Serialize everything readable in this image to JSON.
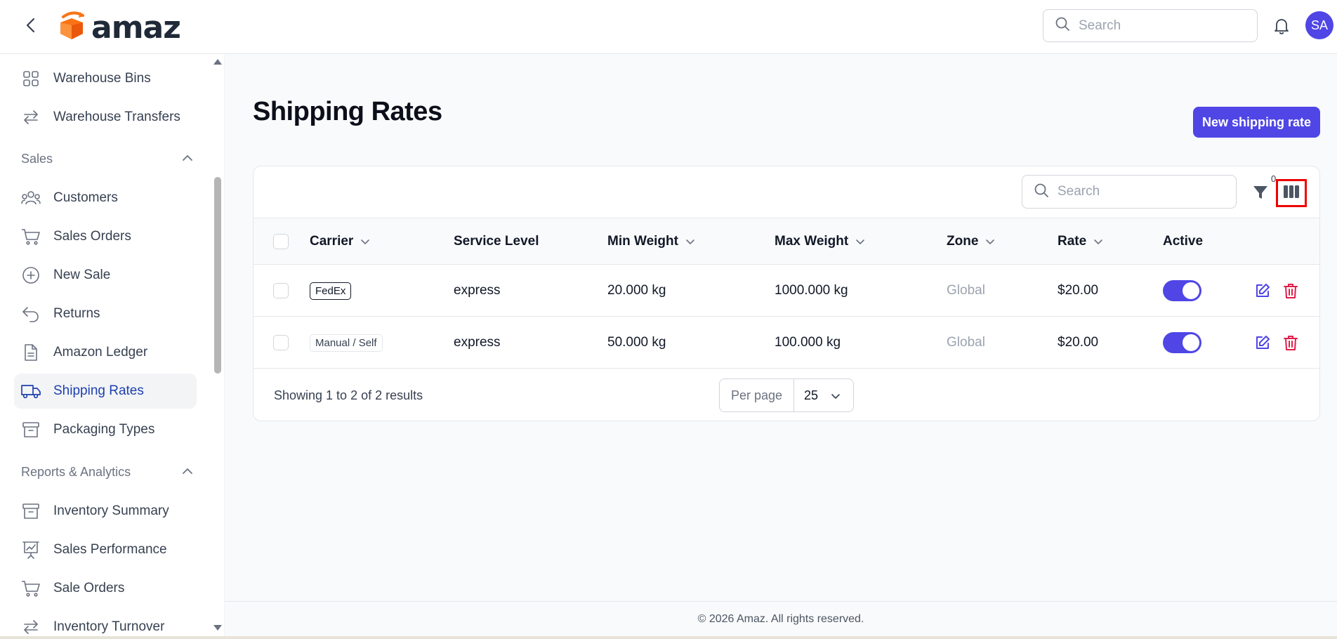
{
  "app": {
    "brand": "amaz",
    "accent": "#4f46e5"
  },
  "topbar": {
    "search_placeholder": "Search",
    "avatar_initials": "SA"
  },
  "sidebar": {
    "items_top": [
      {
        "label": "Warehouse Bins",
        "icon": "grid-icon"
      },
      {
        "label": "Warehouse Transfers",
        "icon": "arrows-left-right-icon"
      }
    ],
    "group_sales": "Sales",
    "items_sales": [
      {
        "label": "Customers",
        "icon": "users-icon"
      },
      {
        "label": "Sales Orders",
        "icon": "cart-icon"
      },
      {
        "label": "New Sale",
        "icon": "plus-circle-icon"
      },
      {
        "label": "Returns",
        "icon": "return-arrow-icon"
      },
      {
        "label": "Amazon Ledger",
        "icon": "document-icon"
      },
      {
        "label": "Shipping Rates",
        "icon": "truck-icon",
        "active": true
      },
      {
        "label": "Packaging Types",
        "icon": "archive-box-icon"
      }
    ],
    "group_reports": "Reports & Analytics",
    "items_reports": [
      {
        "label": "Inventory Summary",
        "icon": "archive-box-icon"
      },
      {
        "label": "Sales Performance",
        "icon": "presentation-chart-icon"
      },
      {
        "label": "Sale Orders",
        "icon": "cart-icon"
      },
      {
        "label": "Inventory Turnover",
        "icon": "arrows-left-right-icon"
      }
    ]
  },
  "page": {
    "title": "Shipping Rates",
    "new_button": "New shipping rate"
  },
  "table": {
    "search_placeholder": "Search",
    "filter_count": "0",
    "columns": [
      "Carrier",
      "Service Level",
      "Min Weight",
      "Max Weight",
      "Zone",
      "Rate",
      "Active"
    ],
    "rows": [
      {
        "carrier": "FedEx",
        "service_level": "express",
        "min_weight": "20.000 kg",
        "max_weight": "1000.000 kg",
        "zone": "Global",
        "rate": "$20.00",
        "active": true
      },
      {
        "carrier": "Manual / Self",
        "service_level": "express",
        "min_weight": "50.000 kg",
        "max_weight": "100.000 kg",
        "zone": "Global",
        "rate": "$20.00",
        "active": true
      }
    ],
    "showing_text": "Showing 1 to 2 of 2 results",
    "per_page_label": "Per page",
    "per_page_value": "25"
  },
  "footer": {
    "copyright": "© 2026 Amaz. All rights reserved."
  }
}
